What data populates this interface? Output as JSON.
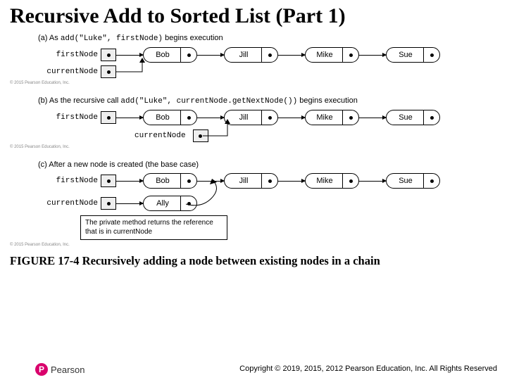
{
  "title": "Recursive Add to Sorted List (Part 1)",
  "panels": {
    "a": {
      "letter": "(a)",
      "pre": "As ",
      "code": "add(\"Luke\", firstNode)",
      "post": " begins execution",
      "firstLabel": "firstNode",
      "currentLabel": "currentNode",
      "nodes": [
        "Bob",
        "Jill",
        "Mike",
        "Sue"
      ],
      "copyright": "© 2015 Pearson Education, Inc."
    },
    "b": {
      "letter": "(b)",
      "pre": "As the recursive call ",
      "code": "add(\"Luke\", currentNode.getNextNode())",
      "post": " begins execution",
      "firstLabel": "firstNode",
      "currentLabel": "currentNode",
      "nodes": [
        "Bob",
        "Jill",
        "Mike",
        "Sue"
      ],
      "copyright": "© 2015 Pearson Education, Inc."
    },
    "c": {
      "letter": "(c)",
      "pre": "After a new node is created (the base case)",
      "firstLabel": "firstNode",
      "currentLabel": "currentNode",
      "nodes": [
        "Bob",
        "Jill",
        "Mike",
        "Sue"
      ],
      "newNode": "Ally",
      "note_pre": "The private method returns the reference that is in ",
      "note_code": "currentNode",
      "copyright": "© 2015 Pearson Education, Inc."
    }
  },
  "figure_caption": "FIGURE 17-4 Recursively adding a node between existing nodes in a chain",
  "footer": "Copyright © 2019, 2015, 2012 Pearson Education, Inc. All Rights Reserved",
  "brand": "Pearson",
  "brand_letter": "P",
  "chart_data": {
    "type": "table",
    "title": "Linked-list states during recursive add(\"Luke\", ...)",
    "states": [
      {
        "id": "a",
        "description": "add(\"Luke\", firstNode) begins execution",
        "chain": [
          "Bob",
          "Jill",
          "Mike",
          "Sue"
        ],
        "firstNode_points_to": "Bob",
        "currentNode_points_to": "Bob"
      },
      {
        "id": "b",
        "description": "recursive call add(\"Luke\", currentNode.getNextNode()) begins execution",
        "chain": [
          "Bob",
          "Jill",
          "Mike",
          "Sue"
        ],
        "firstNode_points_to": "Bob",
        "currentNode_points_to": "Jill"
      },
      {
        "id": "c",
        "description": "After a new node is created (the base case)",
        "chain": [
          "Bob",
          "Jill",
          "Mike",
          "Sue"
        ],
        "firstNode_points_to": "Bob",
        "new_node": "Ally",
        "currentNode_points_to": "Ally",
        "method_returns": "reference in currentNode"
      }
    ]
  }
}
